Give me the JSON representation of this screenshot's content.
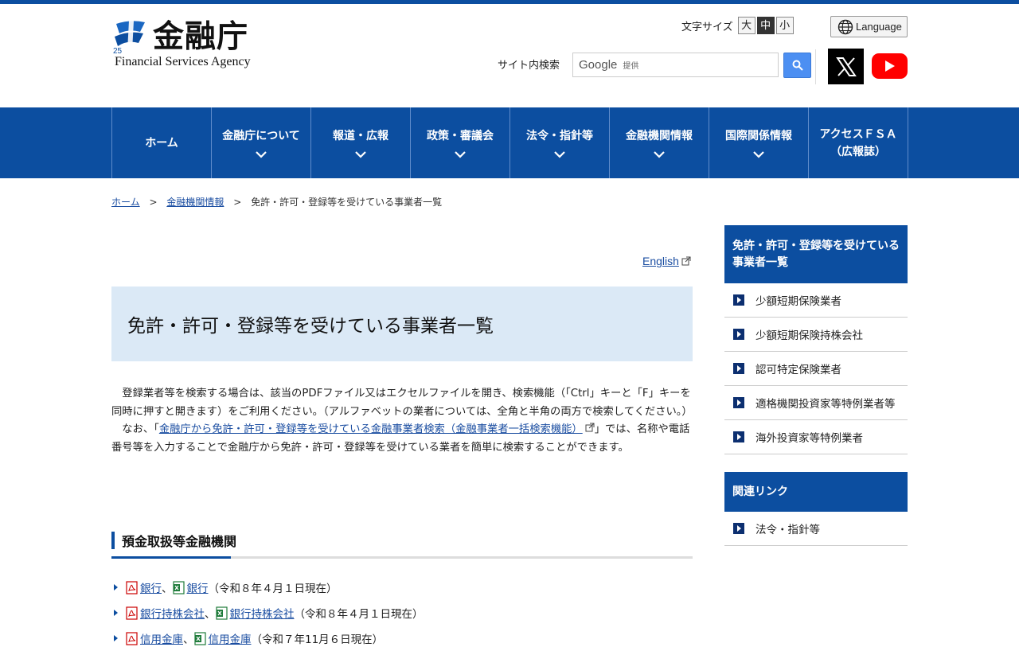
{
  "header": {
    "logo_text": "金融庁",
    "logo_en": "Financial Services Agency",
    "font_size_label": "文字サイズ",
    "font_sizes": [
      "大",
      "中",
      "小"
    ],
    "font_size_active": "中",
    "language_label": "Language",
    "search_label": "サイト内検索",
    "search_brand": "Google",
    "search_brand_suffix": "提供"
  },
  "nav": {
    "items": [
      {
        "label": "ホーム",
        "line2": ""
      },
      {
        "label": "金融庁について",
        "line2": ""
      },
      {
        "label": "報道・広報",
        "line2": ""
      },
      {
        "label": "政策・審議会",
        "line2": ""
      },
      {
        "label": "法令・指針等",
        "line2": ""
      },
      {
        "label": "金融機関情報",
        "line2": ""
      },
      {
        "label": "国際関係情報",
        "line2": ""
      },
      {
        "label": "アクセスＦＳＡ",
        "line2": "（広報誌）"
      }
    ]
  },
  "breadcrumb": {
    "home": "ホーム",
    "level1": "金融機関情報",
    "current": "免許・許可・登録等を受けている事業者一覧",
    "separator": ">"
  },
  "main": {
    "english_link": "English",
    "title": "免許・許可・登録等を受けている事業者一覧",
    "intro_p1": "登録業者等を検索する場合は、該当のPDFファイル又はエクセルファイルを開き、検索機能（「Ctrl」キーと「F」キーを同時に押すと開きます）をご利用ください。（アルファベットの業者については、全角と半角の両方で検索してください。）",
    "intro_p2_before": "なお、「",
    "intro_p2_link": "金融庁から免許・許可・登録等を受けている金融事業者検索（金融事業者一括検索機能）",
    "intro_p2_after": "」では、名称や電話番号等を入力することで金融庁から免許・許可・登録等を受けている業者を簡単に検索することができます。",
    "section_title": "預金取扱等金融機関",
    "items": [
      {
        "pdf": "銀行",
        "xls": "銀行",
        "date": "（令和８年４月１日現在）"
      },
      {
        "pdf": "銀行持株会社",
        "xls": "銀行持株会社",
        "date": "（令和８年４月１日現在）"
      },
      {
        "pdf": "信用金庫",
        "xls": "信用金庫",
        "date": "（令和７年11月６日現在）"
      }
    ],
    "list_separator": "、"
  },
  "sidebar": {
    "heading": "免許・許可・登録等を受けている事業者一覧",
    "items": [
      "少額短期保険業者",
      "少額短期保険持株会社",
      "認可特定保険業者",
      "適格機関投資家等特例業者等",
      "海外投資家等特例業者"
    ],
    "related_heading": "関連リンク",
    "related_items": [
      "法令・指針等"
    ]
  },
  "colors": {
    "brand_blue": "#0c4ea0",
    "title_bg": "#dbe9f6",
    "search_button": "#4c8ff2",
    "youtube_red": "#ff0000"
  }
}
